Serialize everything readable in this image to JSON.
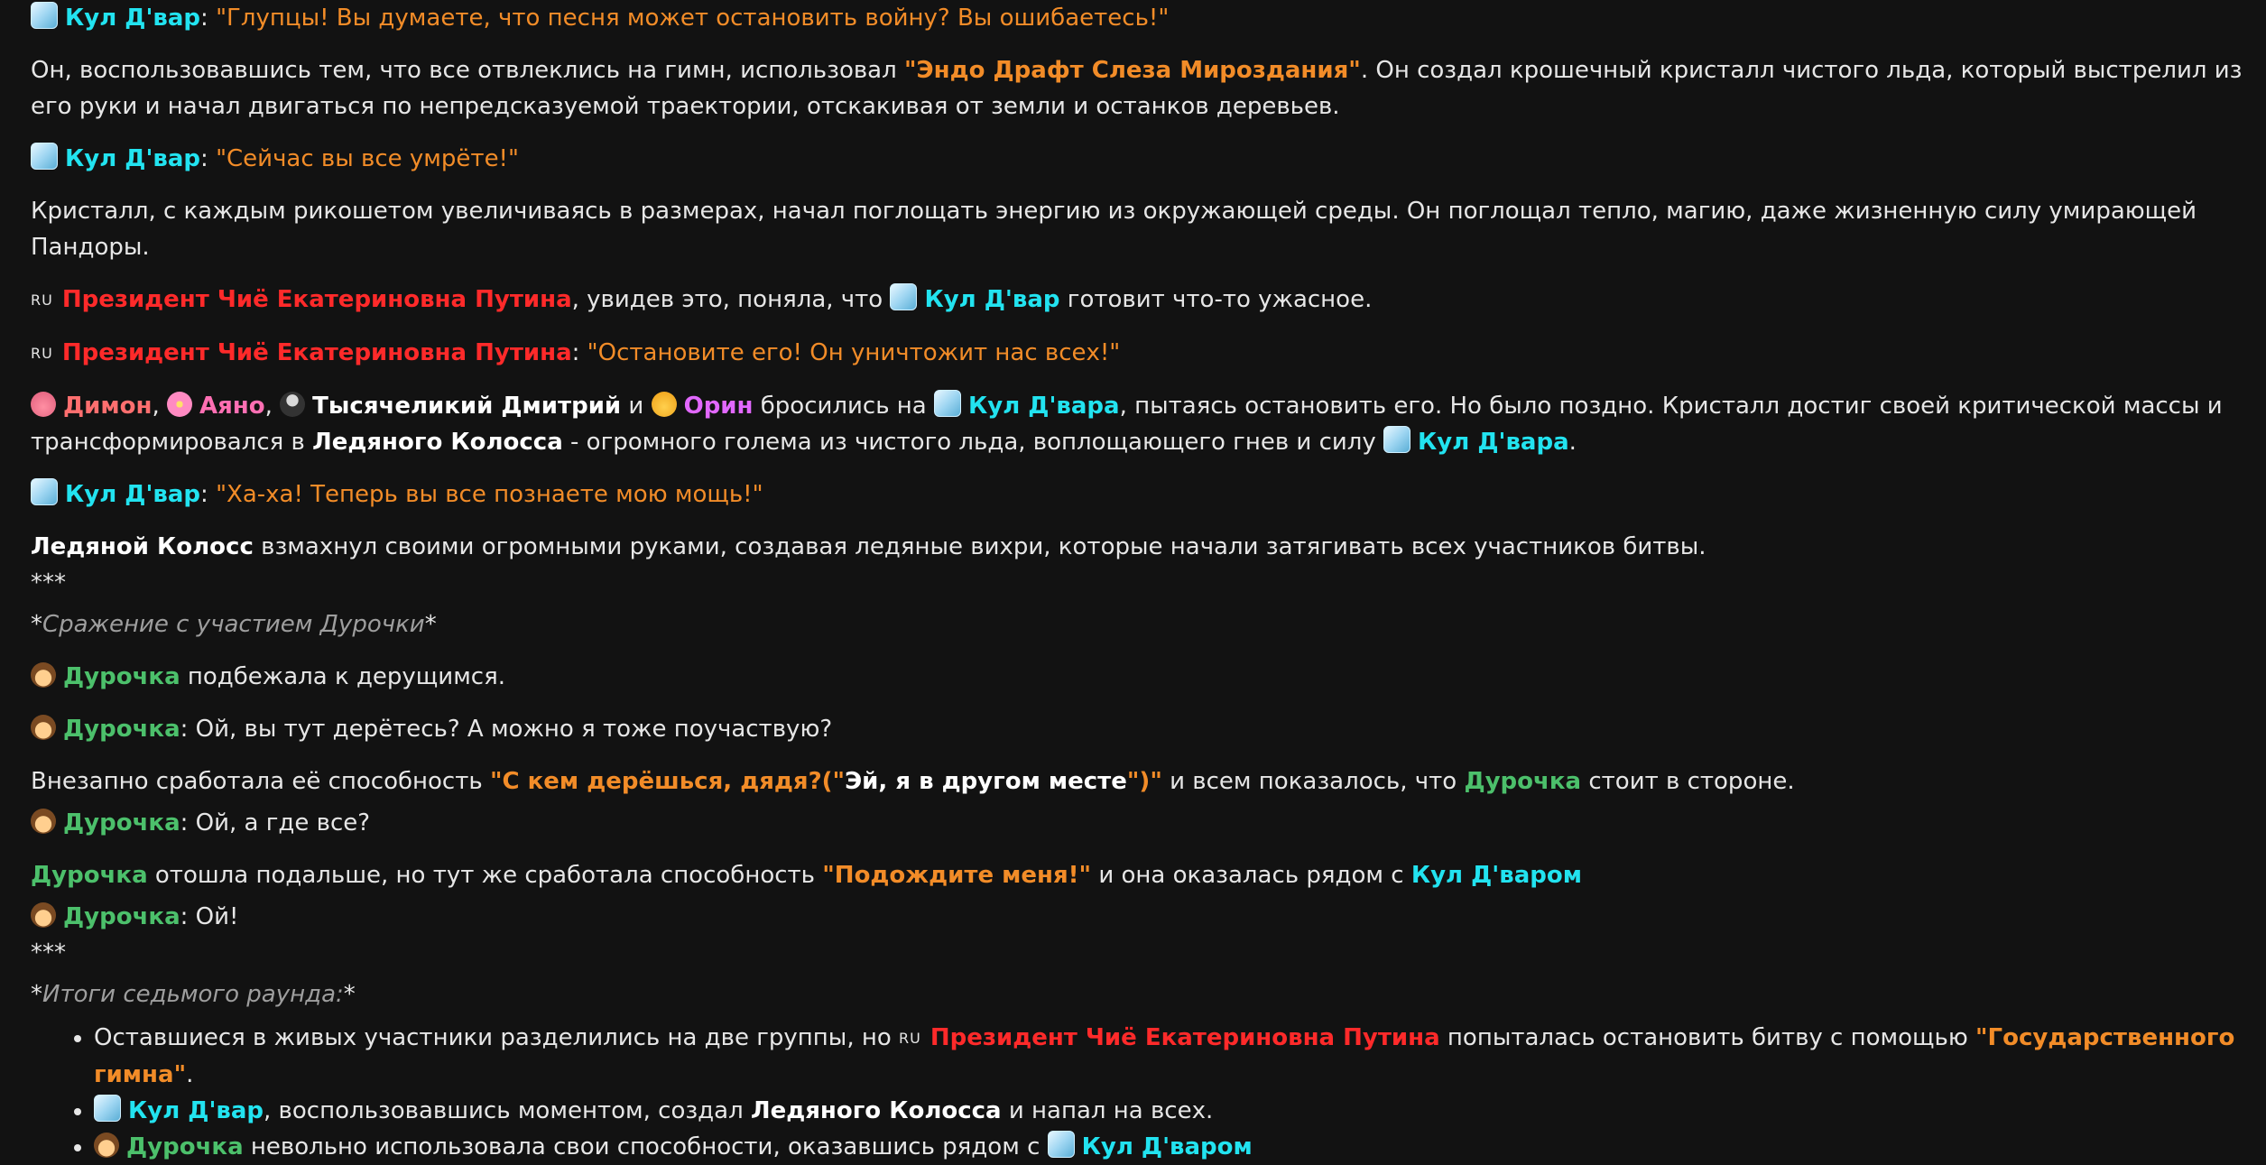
{
  "names": {
    "kul": "Кул Д'вар",
    "kul_gen": "Кул Д'вара",
    "kul_inst": "Кул Д'варом",
    "president": "Президент Чиё Екатериновна Путина",
    "dimon": "Димон",
    "ayano": "Аяно",
    "dmitry": "Тысячеликий Дмитрий",
    "orin": "Орин",
    "durochka": "Дурочка",
    "colossus_gen": "Ледяного Колосса",
    "colossus": "Ледяной Колосс"
  },
  "flag_ru": "RU",
  "icons": {
    "ice": "ice-cube-emoji",
    "pig": "pig-face-emoji",
    "flower": "cherry-blossom-emoji",
    "spy": "spy-emoji",
    "cat": "cat-face-emoji",
    "girl": "person-emoji"
  },
  "colors": {
    "background": "#121212",
    "text": "#e6e6e6",
    "kul": "#22e3f0",
    "president": "#ff2a2a",
    "durochka": "#4cc06b",
    "dimon": "#ff6f6f",
    "ayano": "#ff6fb3",
    "orin": "#e268ff",
    "quote": "#f28c28",
    "italic": "#9e9e9e"
  },
  "lines": {
    "l1_colon": ": ",
    "l1_quote": "\"Глупцы! Вы думаете, что песня может остановить войну? Вы ошибаетесь!\"",
    "l2_a": "Он, воспользовавшись тем, что все отвлеклись на гимн, использовал ",
    "l2_skill": "\"Эндо Драфт Слеза Мироздания\"",
    "l2_b": ". Он создал крошечный кристалл чистого льда, который выстрелил из его руки и начал двигаться по непредсказуемой траектории, отскакивая от земли и останков деревьев.",
    "l3_quote": "\"Сейчас вы все умрёте!\"",
    "l4": "Кристалл, с каждым рикошетом увеличиваясь в размерах, начал поглощать энергию из окружающей среды. Он поглощал тепло, магию, даже жизненную силу умирающей Пандоры.",
    "l5_a": ", увидев это, поняла, что ",
    "l5_b": " готовит что-то ужасное.",
    "l6_quote": "\"Остановите его! Он уничтожит нас всех!\"",
    "l7_comma": ", ",
    "l7_and": " и ",
    "l7_a": " бросились на ",
    "l7_b": ", пытаясь остановить его. Но было поздно. Кристалл достиг своей критической массы и трансформировался в ",
    "l7_c": " - огромного голема из чистого льда, воплощающего гнев и силу ",
    "l7_dot": ".",
    "l8_quote": "\"Ха-ха! Теперь вы все познаете мою мощь!\"",
    "l9": " взмахнул своими огромными руками, создавая ледяные вихри, которые начали затягивать всех участников битвы.",
    "sep": "***",
    "star": "*",
    "battle_title": "Сражение с участием Дурочки",
    "l10": " подбежала к дерущимся.",
    "l11": ": Ой, вы тут дерётесь? А можно я тоже поучаствую?",
    "l12_a": "Внезапно сработала её способность ",
    "l12_skill1": "\"С кем дерёшься, дядя?(\"",
    "l12_skill_inner": "Эй, я в другом месте",
    "l12_skill2": "\")\"",
    "l12_b": " и всем показалось, что ",
    "l12_c": " стоит в стороне.",
    "l13": ": Ой, а где все?",
    "l14_a": " отошла подальше, но тут же сработала способность ",
    "l14_skill": "\"Подождите меня!\"",
    "l14_b": " и она оказалась рядом с ",
    "l15": ": Ой!",
    "results_title": "Итоги седьмого раунда:",
    "li1_a": "Оставшиеся в живых участники разделились на две группы, но ",
    "li1_b": " попыталась остановить битву с помощью ",
    "li1_skill": "\"Государственного гимна\"",
    "li1_dot": ".",
    "li2_a": ", воспользовавшись моментом, создал ",
    "li2_b": " и напал на всех.",
    "li3_a": " невольно использовала свои способности, оказавшись рядом с "
  }
}
